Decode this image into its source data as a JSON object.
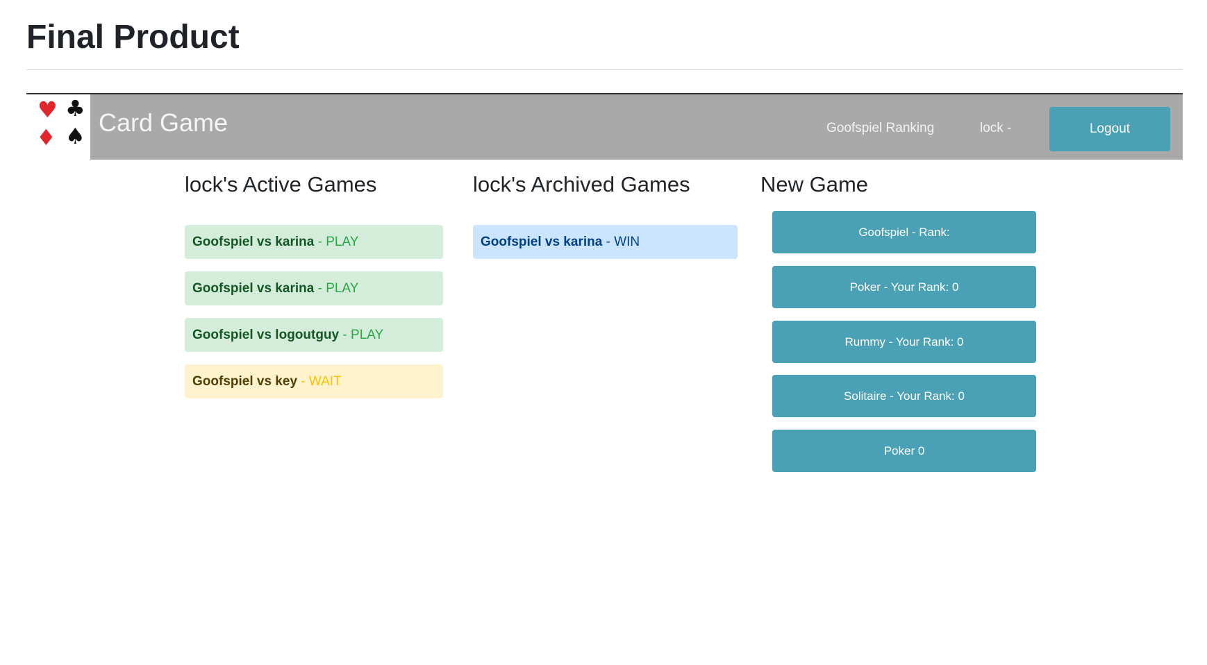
{
  "doc": {
    "title": "Final Product"
  },
  "logo": {
    "suits": [
      {
        "name": "heart-icon",
        "glyph": "♥"
      },
      {
        "name": "club-icon",
        "glyph": "♣"
      },
      {
        "name": "diamond-icon",
        "glyph": "♦"
      },
      {
        "name": "spade-icon",
        "glyph": "♠"
      }
    ]
  },
  "navbar": {
    "brand": "Card Game",
    "ranking_link": "Goofspiel Ranking",
    "user_link": "lock -",
    "logout_label": "Logout",
    "colors": {
      "bar": "#a9a9a9",
      "button": "#4aa0b5"
    }
  },
  "active": {
    "heading": "lock's Active Games",
    "games": [
      {
        "title": "Goofspiel vs karina",
        "sep": " - ",
        "status": "PLAY"
      },
      {
        "title": "Goofspiel vs karina",
        "sep": " - ",
        "status": "PLAY"
      },
      {
        "title": "Goofspiel vs logoutguy",
        "sep": " - ",
        "status": "PLAY"
      },
      {
        "title": "Goofspiel vs key",
        "sep": " - ",
        "status": "WAIT"
      }
    ]
  },
  "archived": {
    "heading": "lock's Archived Games",
    "games": [
      {
        "title": "Goofspiel vs karina",
        "sep": " - ",
        "status": "WIN"
      }
    ]
  },
  "new_game": {
    "heading": "New Game",
    "buttons": [
      "Goofspiel - Rank:",
      "Poker - Your Rank: 0",
      "Rummy - Your Rank: 0",
      "Solitaire - Your Rank: 0",
      "Poker 0"
    ]
  }
}
